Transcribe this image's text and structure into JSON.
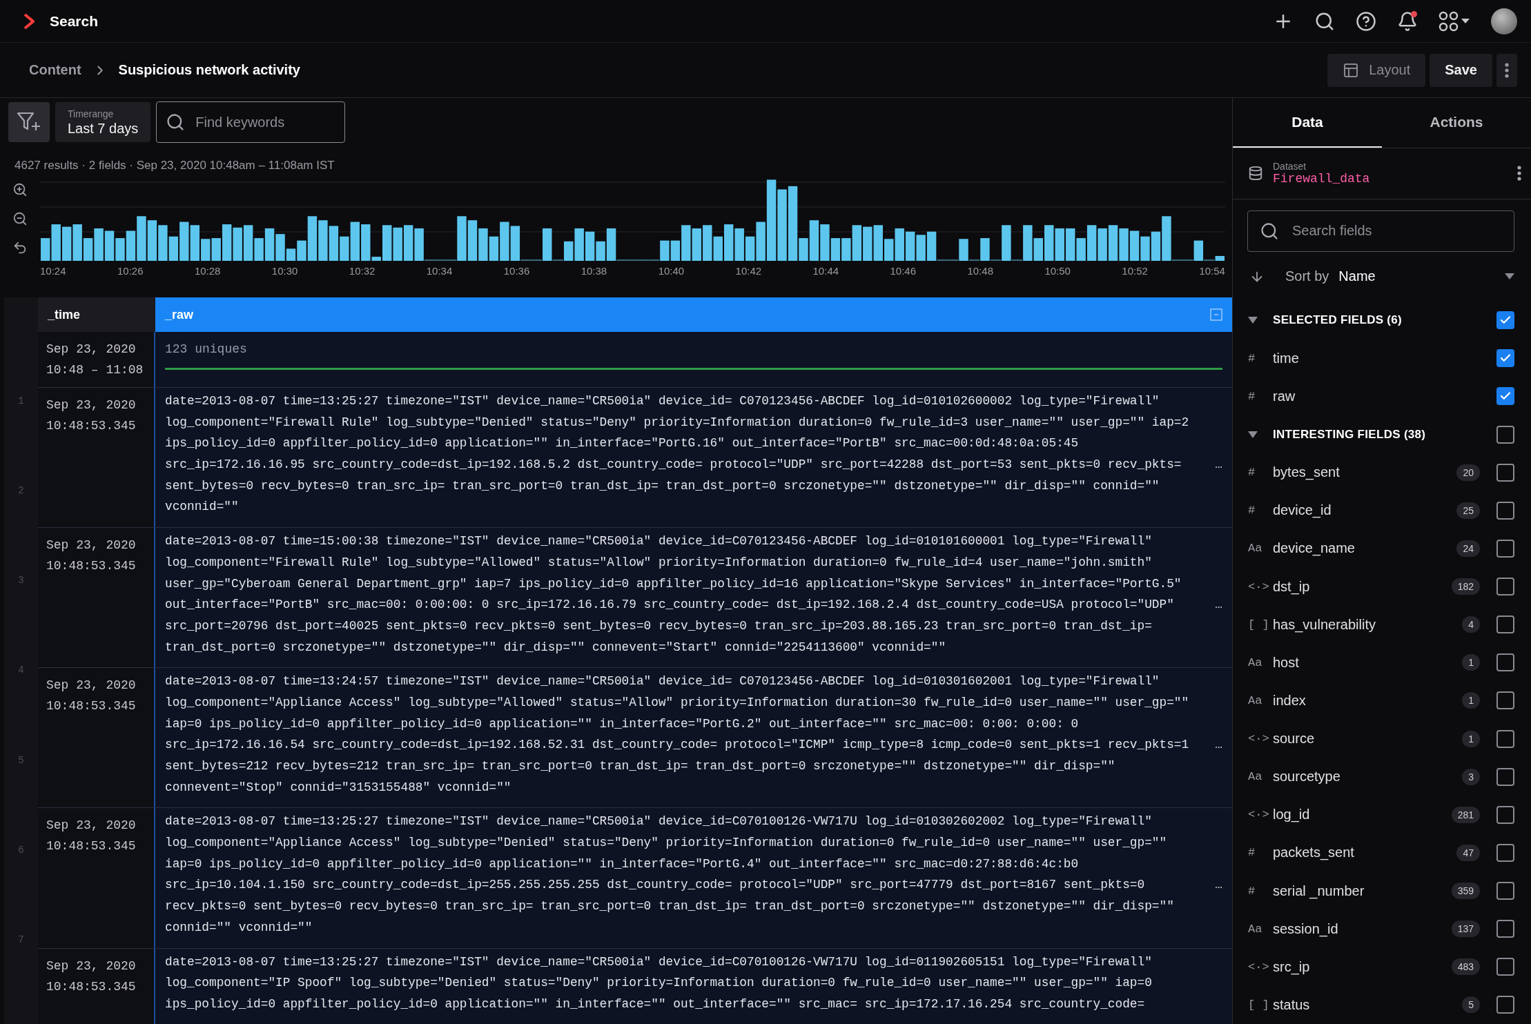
{
  "top_bar": {
    "title": "Search",
    "bell_unread": true
  },
  "breadcrumb": [
    {
      "label": "Content",
      "current": false
    },
    {
      "label": "Suspicious network activity",
      "current": true
    }
  ],
  "actions": {
    "layout": "Layout",
    "save": "Save"
  },
  "toolbar": {
    "timerange": {
      "label": "Timerange",
      "value": "Last 7 days"
    },
    "search": {
      "placeholder": "Find keywords"
    }
  },
  "summary": "4627 results · 2 fields · Sep 23, 2020 10:48am – 11:08am IST",
  "histogram": {
    "x_labels": [
      "10:24",
      "10:26",
      "10:28",
      "10:30",
      "10:32",
      "10:34",
      "10:36",
      "10:38",
      "10:40",
      "10:42",
      "10:44",
      "10:46",
      "10:48",
      "10:50",
      "10:52",
      "10:54"
    ]
  },
  "table": {
    "columns": [
      {
        "label": "_time",
        "selected": false
      },
      {
        "label": "_raw",
        "selected": true
      }
    ],
    "line_numbers": [
      "1",
      "2",
      "3",
      "4",
      "5",
      "6",
      "7"
    ],
    "summary_row": {
      "time_lines": [
        "Sep 23, 2020",
        "10:48 – 11:08"
      ],
      "raw": "123 uniques"
    },
    "rows": [
      {
        "time_lines": [
          "Sep 23, 2020",
          "10:48:53.345"
        ],
        "lines": [
          {
            "text": "date=2013-08-07 time=13:25:27 timezone=\"IST\" device_name=\"CR500ia\" device_id= C070123456-ABCDEF log_id=010102600002 log_type=\"Firewall\""
          },
          {
            "text": "log_component=\"Firewall Rule\" log_subtype=\"Denied\" status=\"Deny\" priority=Information duration=0 fw_rule_id=3 user_name=\"\" user_gp=\"\" iap=2"
          },
          {
            "text": "ips_policy_id=0 appfilter_policy_id=0 application=\"\" in_interface=\"PortG.16\" out_interface=\"PortB\" src_mac=00:0d:48:0a:05:45"
          },
          {
            "text": "src_ip=172.16.16.95 src_country_code=dst_ip=192.168.5.2 dst_country_code= protocol=\"UDP\" src_port=42288 dst_port=53 sent_pkts=0 recv_pkts=",
            "more": "…"
          },
          {
            "text": "sent_bytes=0 recv_bytes=0 tran_src_ip= tran_src_port=0 tran_dst_ip= tran_dst_port=0 srczonetype=\"\" dstzonetype=\"\" dir_disp=\"\" connid=\"\""
          },
          {
            "text": "vconnid=\"\""
          }
        ]
      },
      {
        "time_lines": [
          "Sep 23, 2020",
          "10:48:53.345"
        ],
        "lines": [
          {
            "text": "date=2013-08-07 time=15:00:38 timezone=\"IST\" device_name=\"CR500ia\" device_id=C070123456-ABCDEF log_id=010101600001 log_type=\"Firewall\""
          },
          {
            "text": "log_component=\"Firewall Rule\" log_subtype=\"Allowed\" status=\"Allow\" priority=Information duration=0 fw_rule_id=4 user_name=\"john.smith\""
          },
          {
            "text": "user_gp=\"Cyberoam General Department_grp\" iap=7 ips_policy_id=0 appfilter_policy_id=16 application=\"Skype Services\" in_interface=\"PortG.5\""
          },
          {
            "text": "out_interface=\"PortB\" src_mac=00: 0:00:00: 0 src_ip=172.16.16.79 src_country_code= dst_ip=192.168.2.4 dst_country_code=USA protocol=\"UDP\"",
            "more": "…"
          },
          {
            "text": "src_port=20796 dst_port=40025 sent_pkts=0 recv_pkts=0 sent_bytes=0 recv_bytes=0 tran_src_ip=203.88.165.23 tran_src_port=0 tran_dst_ip="
          },
          {
            "text": "tran_dst_port=0 srczonetype=\"\" dstzonetype=\"\" dir_disp=\"\" connevent=\"Start\" connid=\"2254113600\" vconnid=\"\""
          }
        ]
      },
      {
        "time_lines": [
          "Sep 23, 2020",
          "10:48:53.345"
        ],
        "lines": [
          {
            "text": "date=2013-08-07 time=13:24:57 timezone=\"IST\" device_name=\"CR500ia\" device_id= C070123456-ABCDEF log_id=010301602001 log_type=\"Firewall\""
          },
          {
            "text": "log_component=\"Appliance Access\" log_subtype=\"Allowed\" status=\"Allow\" priority=Information duration=30 fw_rule_id=0 user_name=\"\" user_gp=\"\""
          },
          {
            "text": "iap=0 ips_policy_id=0 appfilter_policy_id=0 application=\"\" in_interface=\"PortG.2\" out_interface=\"\" src_mac=00: 0:00: 0:00: 0"
          },
          {
            "text": "src_ip=172.16.16.54 src_country_code=dst_ip=192.168.52.31 dst_country_code= protocol=\"ICMP\" icmp_type=8 icmp_code=0 sent_pkts=1 recv_pkts=1",
            "more": "…"
          },
          {
            "text": "sent_bytes=212 recv_bytes=212 tran_src_ip= tran_src_port=0 tran_dst_ip= tran_dst_port=0 srczonetype=\"\" dstzonetype=\"\" dir_disp=\"\""
          },
          {
            "text": "connevent=\"Stop\" connid=\"3153155488\" vconnid=\"\""
          }
        ]
      },
      {
        "time_lines": [
          "Sep 23, 2020",
          "10:48:53.345"
        ],
        "lines": [
          {
            "text": "date=2013-08-07 time=13:25:27 timezone=\"IST\" device_name=\"CR500ia\" device_id=C070100126-VW717U log_id=010302602002 log_type=\"Firewall\""
          },
          {
            "text": "log_component=\"Appliance Access\" log_subtype=\"Denied\" status=\"Deny\" priority=Information duration=0 fw_rule_id=0 user_name=\"\" user_gp=\"\""
          },
          {
            "text": "iap=0 ips_policy_id=0 appfilter_policy_id=0 application=\"\" in_interface=\"PortG.4\" out_interface=\"\" src_mac=d0:27:88:d6:4c:b0"
          },
          {
            "text": "src_ip=10.104.1.150 src_country_code=dst_ip=255.255.255.255 dst_country_code= protocol=\"UDP\" src_port=47779 dst_port=8167 sent_pkts=0",
            "more": "…"
          },
          {
            "text": "recv_pkts=0 sent_bytes=0 recv_bytes=0 tran_src_ip= tran_src_port=0 tran_dst_ip= tran_dst_port=0 srczonetype=\"\" dstzonetype=\"\" dir_disp=\"\""
          },
          {
            "text": "connid=\"\" vconnid=\"\""
          }
        ]
      },
      {
        "time_lines": [
          "Sep 23, 2020",
          "10:48:53.345"
        ],
        "lines": [
          {
            "text": "date=2013-08-07 time=13:25:27 timezone=\"IST\" device_name=\"CR500ia\" device_id=C070100126-VW717U log_id=011902605151 log_type=\"Firewall\""
          },
          {
            "text": "log_component=\"IP Spoof\" log_subtype=\"Denied\" status=\"Deny\" priority=Information duration=0 fw_rule_id=0 user_name=\"\" user_gp=\"\" iap=0"
          },
          {
            "text": "ips_policy_id=0 appfilter_policy_id=0 application=\"\" in_interface=\"\" out_interface=\"\" src_mac= src_ip=172.17.16.254 src_country_code="
          }
        ]
      }
    ]
  },
  "panel": {
    "tabs": [
      {
        "label": "Data",
        "selected": true
      },
      {
        "label": "Actions",
        "selected": false
      }
    ],
    "dataset": {
      "label": "Dataset",
      "name": "Firewall_data"
    },
    "search": {
      "placeholder": "Search fields"
    },
    "sort": {
      "label": "Sort by",
      "value": "Name"
    },
    "sections": [
      {
        "title": "SELECTED FIELDS (6)",
        "expanded": true,
        "checked": true,
        "fields": [
          {
            "type": "#",
            "name": "time",
            "checked": true
          },
          {
            "type": "#",
            "name": "raw",
            "checked": true
          }
        ]
      },
      {
        "title": "INTERESTING FIELDS (38)",
        "expanded": true,
        "checked": false,
        "fields": [
          {
            "type": "#",
            "name": "bytes_sent",
            "count": "20",
            "checked": false
          },
          {
            "type": "#",
            "name": "device_id",
            "count": "25",
            "checked": false
          },
          {
            "type": "Aa",
            "name": "device_name",
            "count": "24",
            "checked": false
          },
          {
            "type": "<·>",
            "name": "dst_ip",
            "count": "182",
            "checked": false
          },
          {
            "type": "[ ]",
            "name": "has_vulnerability",
            "count": "4",
            "checked": false
          },
          {
            "type": "Aa",
            "name": "host",
            "count": "1",
            "checked": false
          },
          {
            "type": "Aa",
            "name": "index",
            "count": "1",
            "checked": false
          },
          {
            "type": "<·>",
            "name": "source",
            "count": "1",
            "checked": false
          },
          {
            "type": "Aa",
            "name": "sourcetype",
            "count": "3",
            "checked": false
          },
          {
            "type": "<·>",
            "name": "log_id",
            "count": "281",
            "checked": false
          },
          {
            "type": "#",
            "name": "packets_sent",
            "count": "47",
            "checked": false
          },
          {
            "type": "#",
            "name": "serial _number",
            "count": "359",
            "checked": false
          },
          {
            "type": "Aa",
            "name": "session_id",
            "count": "137",
            "checked": false
          },
          {
            "type": "<·>",
            "name": "src_ip",
            "count": "483",
            "checked": false
          },
          {
            "type": "[ ]",
            "name": "status",
            "count": "5",
            "checked": false
          }
        ]
      }
    ]
  }
}
